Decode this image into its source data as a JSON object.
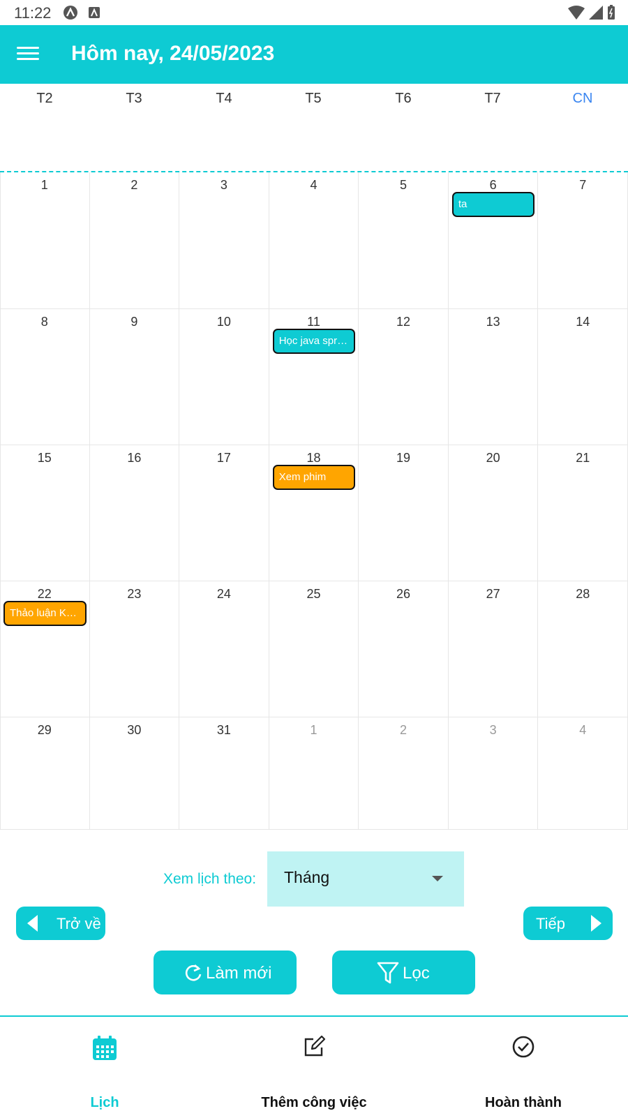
{
  "status_bar": {
    "time": "11:22"
  },
  "appbar": {
    "title": "Hôm nay, 24/05/2023"
  },
  "weekdays": [
    "T2",
    "T3",
    "T4",
    "T5",
    "T6",
    "T7",
    "CN"
  ],
  "calendar": {
    "weeks": [
      [
        {
          "day": "1"
        },
        {
          "day": "2"
        },
        {
          "day": "3"
        },
        {
          "day": "4"
        },
        {
          "day": "5"
        },
        {
          "day": "6"
        },
        {
          "day": "7"
        }
      ],
      [
        {
          "day": "8"
        },
        {
          "day": "9"
        },
        {
          "day": "10"
        },
        {
          "day": "11"
        },
        {
          "day": "12"
        },
        {
          "day": "13"
        },
        {
          "day": "14"
        }
      ],
      [
        {
          "day": "15"
        },
        {
          "day": "16"
        },
        {
          "day": "17"
        },
        {
          "day": "18"
        },
        {
          "day": "19"
        },
        {
          "day": "20"
        },
        {
          "day": "21"
        }
      ],
      [
        {
          "day": "22"
        },
        {
          "day": "23"
        },
        {
          "day": "24"
        },
        {
          "day": "25"
        },
        {
          "day": "26"
        },
        {
          "day": "27"
        },
        {
          "day": "28"
        }
      ],
      [
        {
          "day": "29"
        },
        {
          "day": "30"
        },
        {
          "day": "31"
        },
        {
          "day": "1",
          "other_month": true
        },
        {
          "day": "2",
          "other_month": true
        },
        {
          "day": "3",
          "other_month": true
        },
        {
          "day": "4",
          "other_month": true
        }
      ]
    ],
    "events": [
      {
        "label": "ta",
        "week": 0,
        "col": 5,
        "color": "teal"
      },
      {
        "label": "Học java spring",
        "week": 1,
        "col": 3,
        "color": "teal"
      },
      {
        "label": "Xem phim",
        "week": 2,
        "col": 3,
        "color": "orange"
      },
      {
        "label": "Thảo luận KLTN",
        "week": 3,
        "col": 0,
        "color": "orange"
      }
    ]
  },
  "controls": {
    "view_label": "Xem lịch theo:",
    "view_value": "Tháng",
    "back_label": "Trở về",
    "next_label": "Tiếp",
    "refresh_label": "Làm mới",
    "filter_label": "Lọc"
  },
  "bottom_nav": [
    {
      "label": "Lịch",
      "icon": "calendar-icon",
      "active": true
    },
    {
      "label": "Thêm công việc",
      "icon": "edit-icon",
      "active": false
    },
    {
      "label": "Hoàn thành",
      "icon": "check-circle-icon",
      "active": false
    }
  ],
  "colors": {
    "accent": "#0ecbd3",
    "event_teal": "#0ecbd3",
    "event_orange": "#ffa500",
    "sunday": "#3b86f0",
    "select_bg": "#bff3f3"
  }
}
